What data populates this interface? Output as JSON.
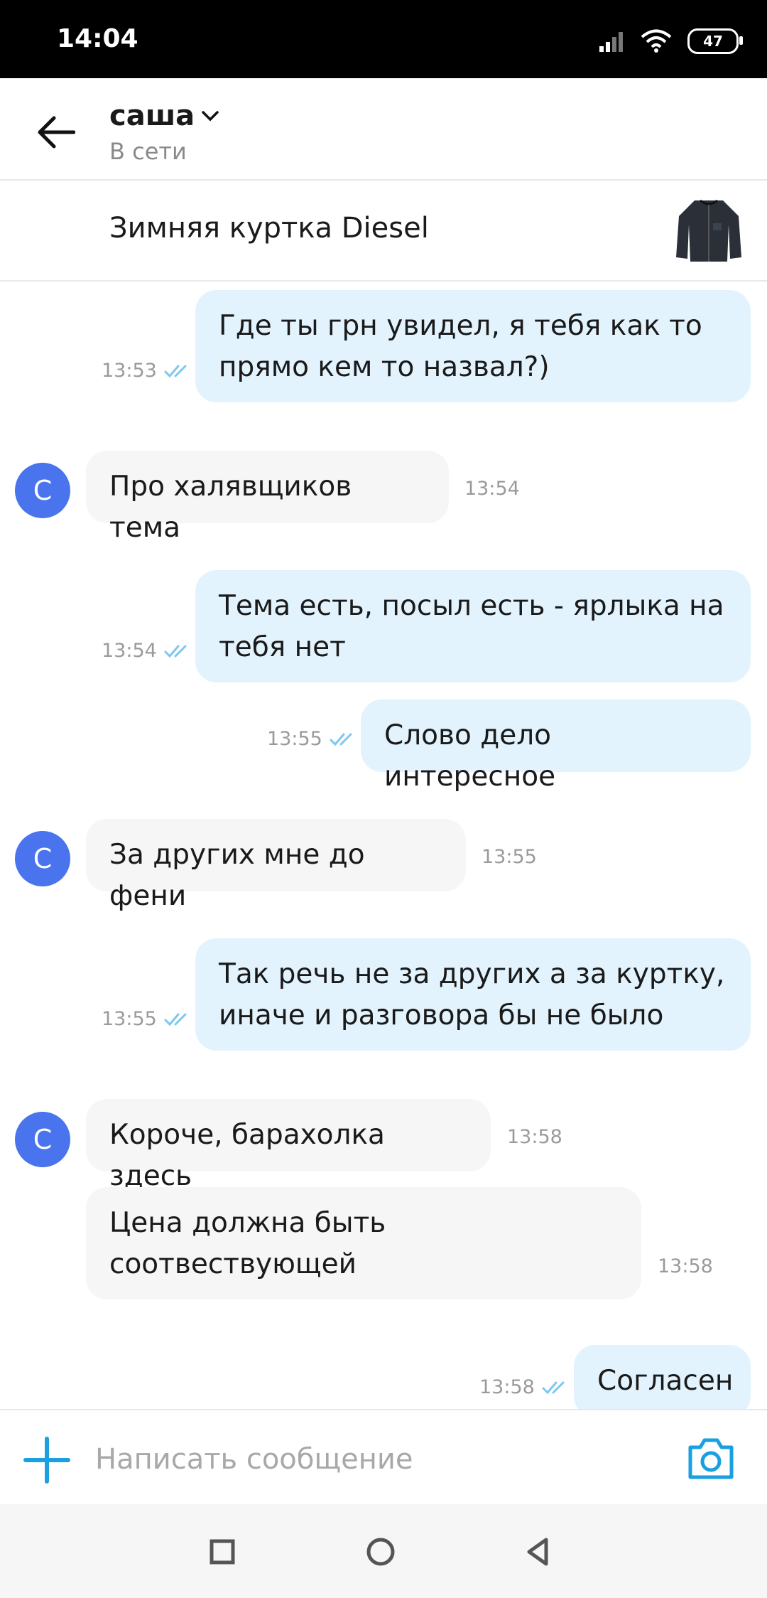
{
  "status_bar": {
    "time": "14:04",
    "battery": "47"
  },
  "header": {
    "contact_name": "саша",
    "contact_status": "В сети"
  },
  "product": {
    "title": "Зимняя куртка Diesel"
  },
  "avatar_letter": "С",
  "messages": [
    {
      "direction": "out",
      "text": "Где ты грн увидел, я тебя как то прямо кем то назвал?)",
      "time": "13:53"
    },
    {
      "direction": "in",
      "text": "Про халявщиков тема",
      "time": "13:54"
    },
    {
      "direction": "out",
      "text": "Тема есть, посыл есть - ярлыка на тебя нет",
      "time": "13:54"
    },
    {
      "direction": "out",
      "text": "Слово дело интересное",
      "time": "13:55"
    },
    {
      "direction": "in",
      "text": "За других мне до фени",
      "time": "13:55"
    },
    {
      "direction": "out",
      "text": "Так речь не за других а за куртку, иначе и разговора бы не было",
      "time": "13:55"
    },
    {
      "direction": "in",
      "text": "Короче, барахолка здесь",
      "time": "13:58"
    },
    {
      "direction": "in",
      "text": "Цена должна быть соотвествующей",
      "time": "13:58"
    },
    {
      "direction": "out",
      "text": "Согласен",
      "time": "13:58"
    }
  ],
  "composer": {
    "placeholder": "Написать сообщение"
  },
  "colors": {
    "accent": "#1a9fe0",
    "avatar": "#4a74ee",
    "out_bubble": "#e3f3fd",
    "in_bubble": "#f6f6f6"
  },
  "icons": [
    "back-arrow-icon",
    "chevron-down-icon",
    "plus-icon",
    "camera-icon",
    "double-check-icon",
    "signal-icon",
    "wifi-icon",
    "battery-icon",
    "nav-square-icon",
    "nav-circle-icon",
    "nav-triangle-icon"
  ]
}
